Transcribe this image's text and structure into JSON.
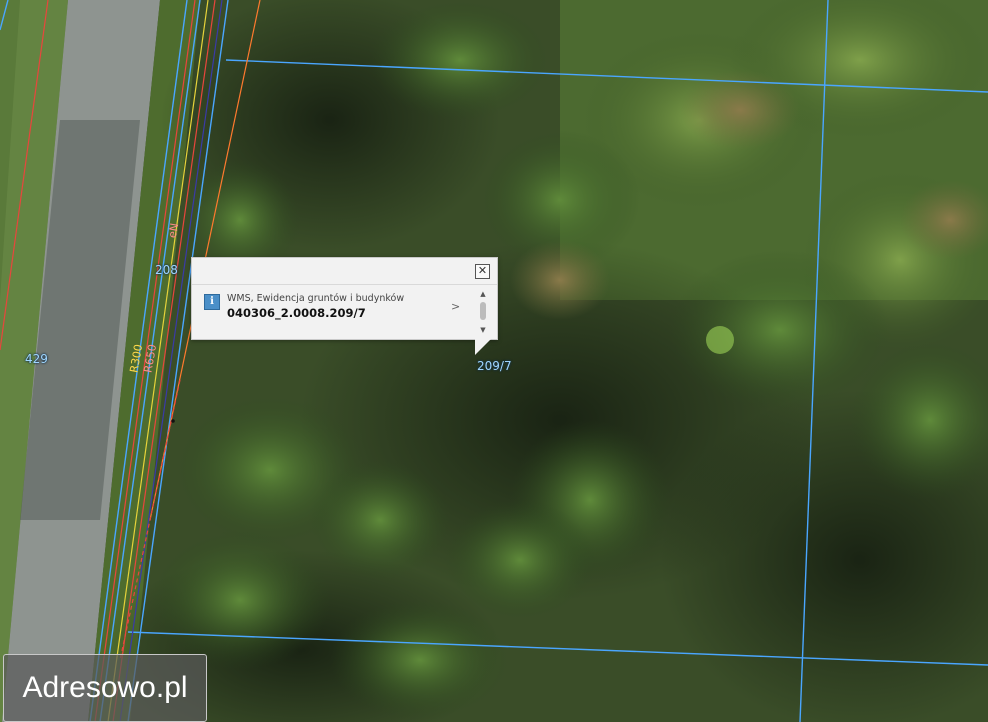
{
  "map": {
    "parcel_labels": [
      "208",
      "429",
      "209/7"
    ],
    "utility_labels": [
      "eN",
      "R300",
      "R650"
    ],
    "colors": {
      "parcel_border": "#4aa6ff",
      "utility_red": "#e8463c",
      "utility_yellow": "#e6d23a",
      "utility_orange": "#ff7a2e"
    }
  },
  "popup": {
    "close_icon": "close-icon",
    "info_icon_glyph": "i",
    "layer_name": "WMS, Ewidencja gruntów i budynków",
    "feature_id": "040306_2.0008.209/7",
    "expand_glyph": ">",
    "scroll_up_glyph": "▲",
    "scroll_down_glyph": "▼"
  },
  "watermark": {
    "text": "Adresowo.pl"
  }
}
